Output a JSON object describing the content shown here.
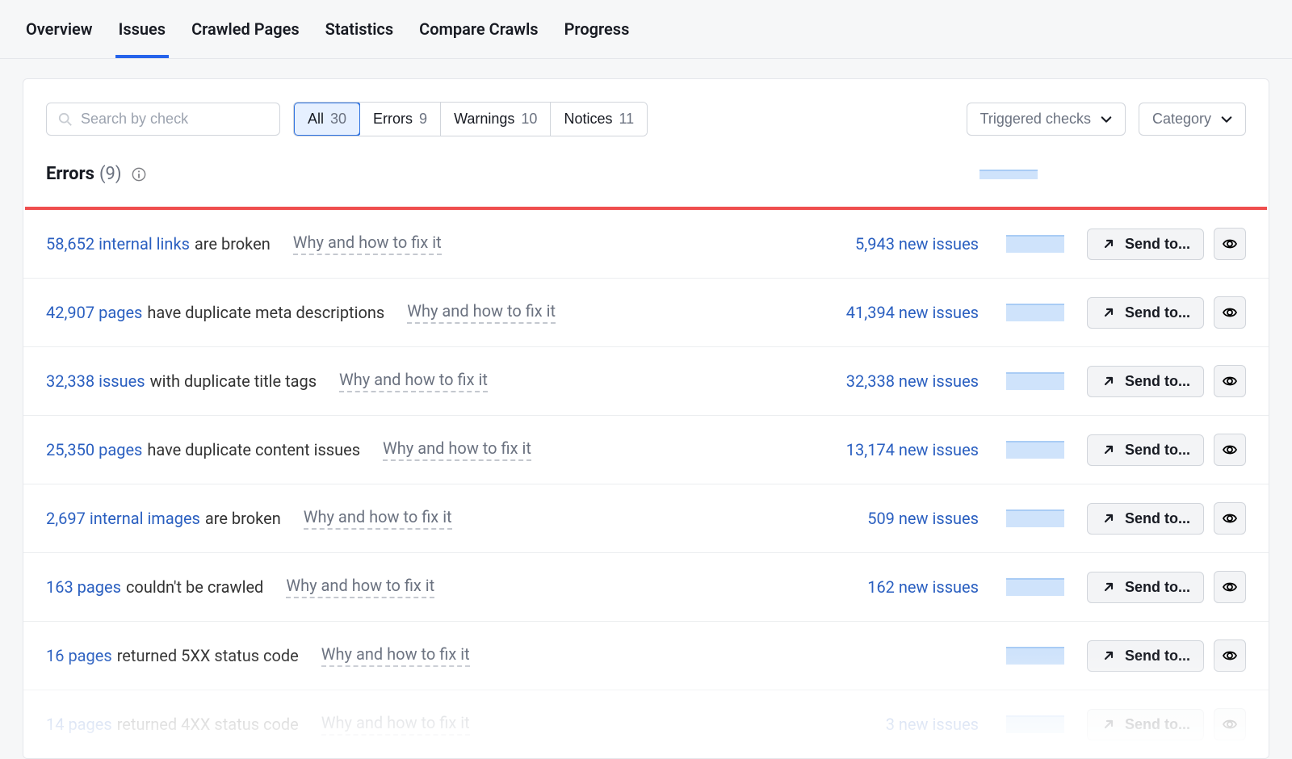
{
  "nav": {
    "tabs": [
      "Overview",
      "Issues",
      "Crawled Pages",
      "Statistics",
      "Compare Crawls",
      "Progress"
    ],
    "active": 1
  },
  "search": {
    "placeholder": "Search by check"
  },
  "segments": [
    {
      "label": "All",
      "count": "30",
      "active": true
    },
    {
      "label": "Errors",
      "count": "9",
      "active": false
    },
    {
      "label": "Warnings",
      "count": "10",
      "active": false
    },
    {
      "label": "Notices",
      "count": "11",
      "active": false
    }
  ],
  "dropdowns": {
    "triggered": "Triggered checks",
    "category": "Category"
  },
  "section": {
    "title": "Errors",
    "count": "(9)"
  },
  "fix_label": "Why and how to fix it",
  "send_label": "Send to...",
  "issues": [
    {
      "link": "58,652 internal links",
      "rest": "are broken",
      "new": "5,943 new issues"
    },
    {
      "link": "42,907 pages",
      "rest": "have duplicate meta descriptions",
      "new": "41,394 new issues"
    },
    {
      "link": "32,338 issues",
      "rest": "with duplicate title tags",
      "new": "32,338 new issues"
    },
    {
      "link": "25,350 pages",
      "rest": "have duplicate content issues",
      "new": "13,174 new issues"
    },
    {
      "link": "2,697 internal images",
      "rest": "are broken",
      "new": "509 new issues"
    },
    {
      "link": "163 pages",
      "rest": "couldn't be crawled",
      "new": "162 new issues"
    },
    {
      "link": "16 pages",
      "rest": "returned 5XX status code",
      "new": ""
    },
    {
      "link": "14 pages",
      "rest": "returned 4XX status code",
      "new": "3 new issues"
    }
  ]
}
